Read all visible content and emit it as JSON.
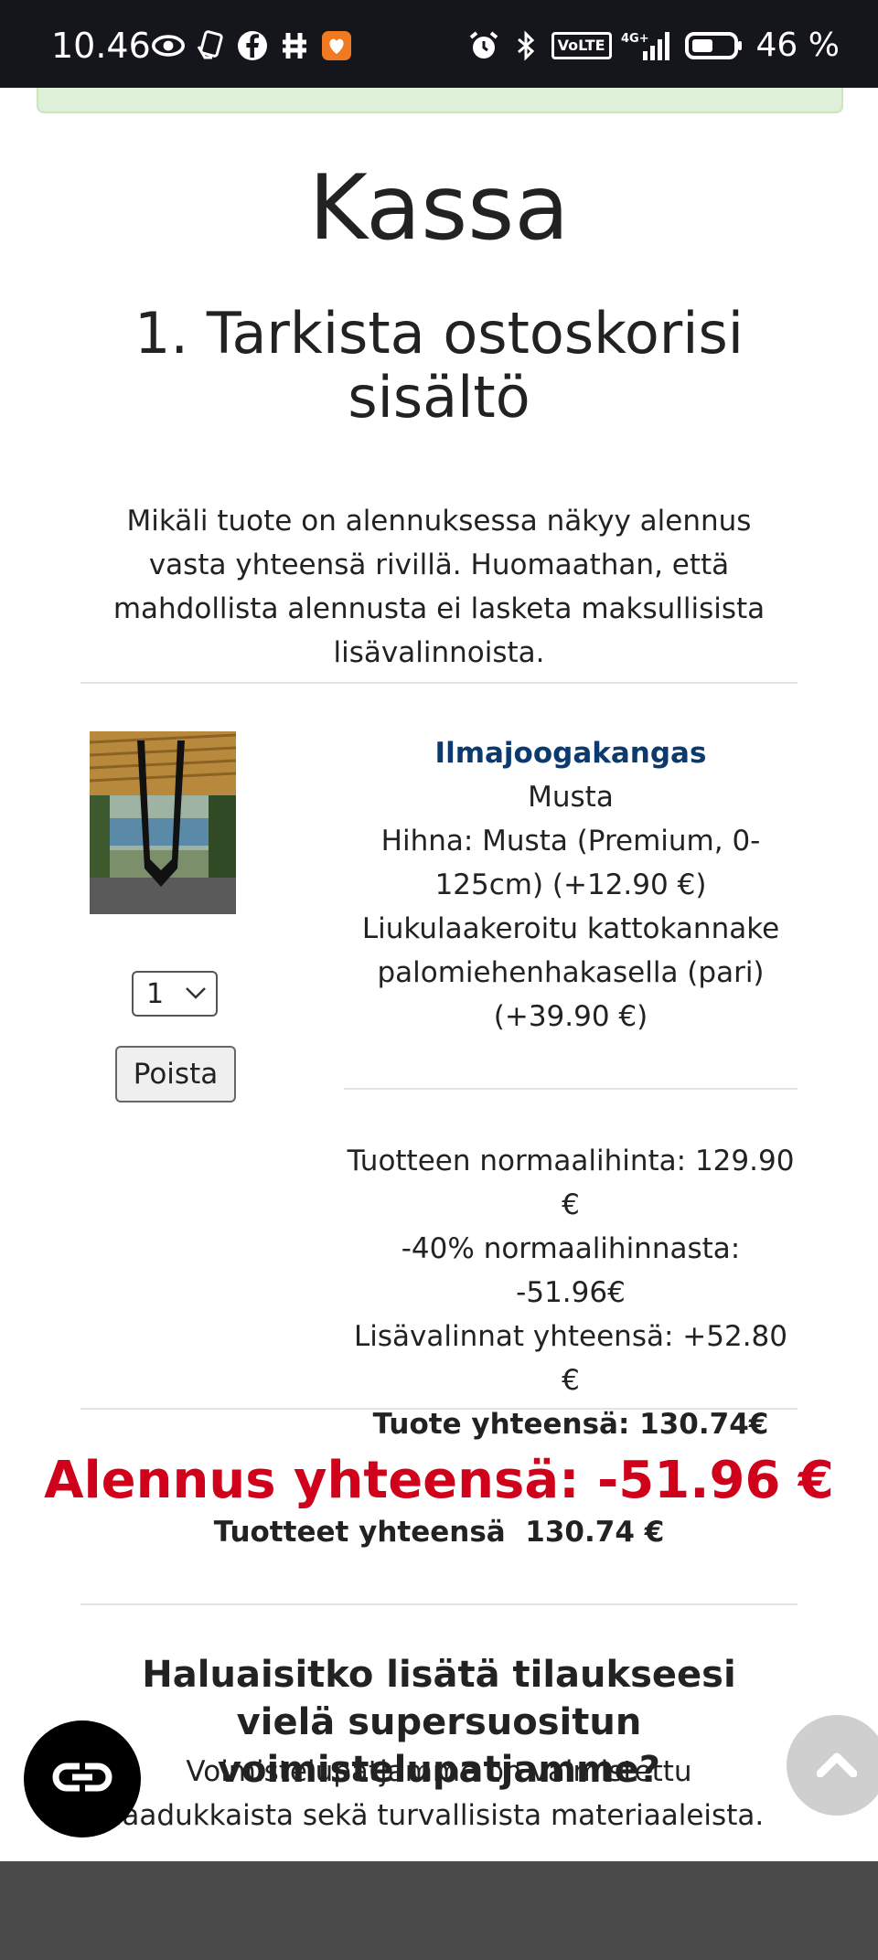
{
  "status_bar": {
    "time": "10.46",
    "battery_percent": "46 %",
    "left_icons": [
      "eye-icon",
      "hand-card-icon",
      "facebook-icon",
      "hashtag-icon",
      "shield-heart-icon"
    ],
    "right_icons": [
      "alarm-icon",
      "bluetooth-icon",
      "volte-icon",
      "signal-4g-icon",
      "battery-icon"
    ],
    "volte_label": "VoLTE",
    "network_label": "4G+"
  },
  "page": {
    "title": "Kassa",
    "step_title": "1. Tarkista ostoskorisi sisältö",
    "intro": "Mikäli tuote on alennuksessa näkyy alennus vasta yhteensä rivillä. Huomaathan, että mahdollista alennusta ei lasketa maksullisista lisävalinnoista."
  },
  "cart_item": {
    "name": "Ilmajoogakangas",
    "color": "Musta",
    "option_strap": "Hihna: Musta (Premium, 0-125cm) (+12.90 €)",
    "option_mount": "Liukulaakeroitu kattokannake palomiehenhakasella (pari) (+39.90 €)",
    "quantity": "1",
    "remove_label": "Poista",
    "normal_price": "Tuotteen normaalihinta: 129.90 €",
    "discount": "-40% normaalihinnasta: -51.96€",
    "options_total": "Lisävalinnat yhteensä: +52.80 €",
    "item_total": "Tuote yhteensä: 130.74€"
  },
  "summary": {
    "discount_total": "Alennus yhteensä: -51.96 €",
    "items_total": "Tuotteet yhteensä  130.74 €"
  },
  "upsell": {
    "title": "Haluaisitko lisätä tilaukseesi vielä supersuositun voimistelupatjamme?",
    "text": "Voimistelupatjamme on valmistettu laadukkaista sekä turvallisista materiaaleista."
  },
  "colors": {
    "accent_red": "#d0021b",
    "product_link": "#0b3a6e",
    "status_bar_bg": "#15161b",
    "footer_bg": "#4a4a4a"
  }
}
